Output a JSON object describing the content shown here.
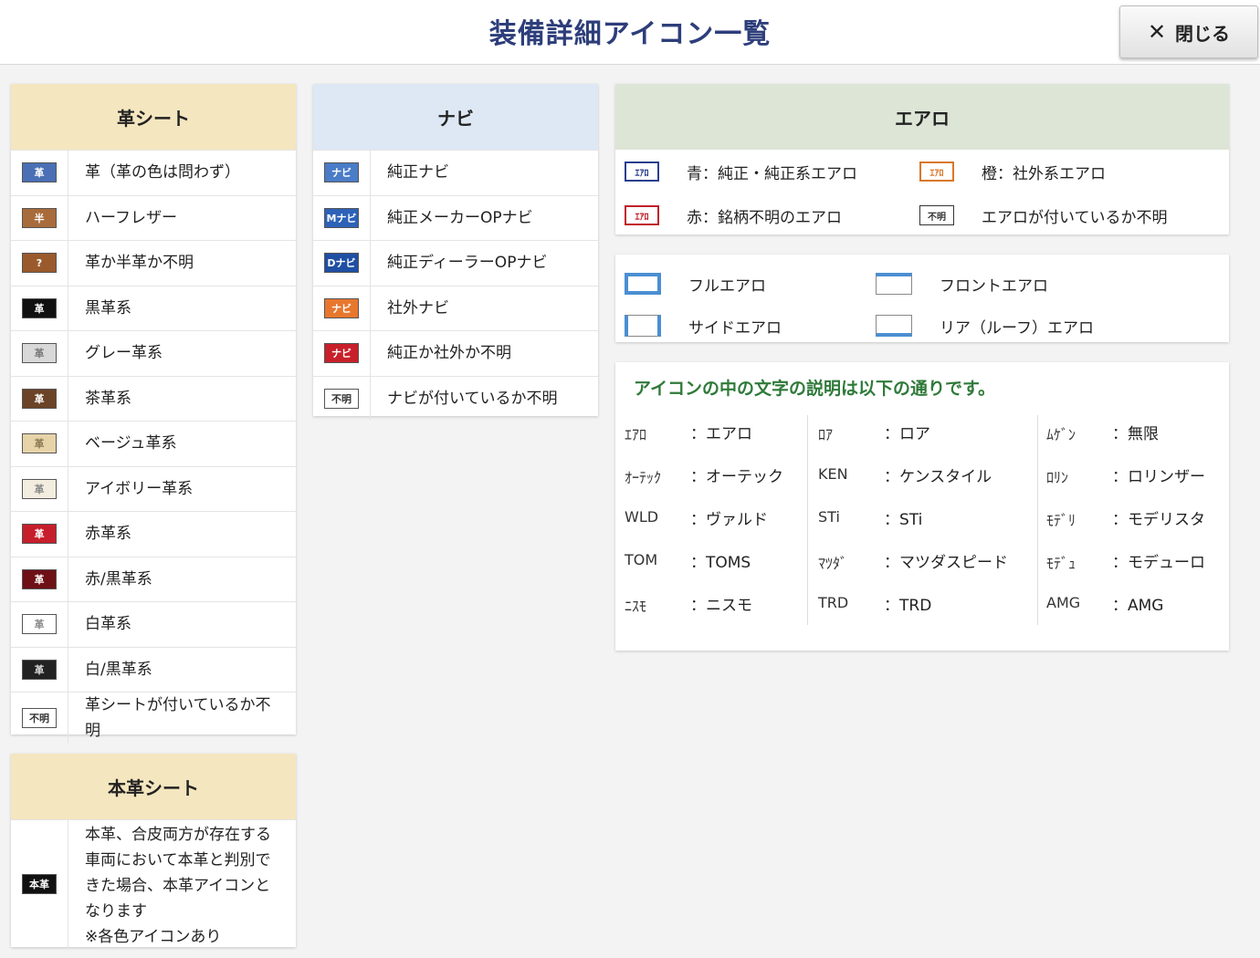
{
  "header": {
    "title": "装備詳細アイコン一覧",
    "close_label": "閉じる"
  },
  "leather": {
    "title": "革シート",
    "items": [
      {
        "icon": "革",
        "bg": "#4a6fb5",
        "fg": "#ffffff",
        "label": "革（革の色は問わず）"
      },
      {
        "icon": "半",
        "bg": "#a86b3b",
        "fg": "#ffffff",
        "label": "ハーフレザー"
      },
      {
        "icon": "?",
        "bg": "#9a5a2c",
        "fg": "#ffffff",
        "label": "革か半革か不明"
      },
      {
        "icon": "革",
        "bg": "#111111",
        "fg": "#ffffff",
        "label": "黒革系"
      },
      {
        "icon": "革",
        "bg": "#d8d8d8",
        "fg": "#777777",
        "label": "グレー革系"
      },
      {
        "icon": "革",
        "bg": "#6b4326",
        "fg": "#ffffff",
        "label": "茶革系"
      },
      {
        "icon": "革",
        "bg": "#e6d3a8",
        "fg": "#8a7650",
        "label": "ベージュ革系"
      },
      {
        "icon": "革",
        "bg": "#f3ede0",
        "fg": "#888888",
        "label": "アイボリー革系"
      },
      {
        "icon": "革",
        "bg": "#c71e2b",
        "fg": "#ffffff",
        "label": "赤革系"
      },
      {
        "icon": "革",
        "bg": "#6e1016",
        "fg": "#ffffff",
        "label": "赤/黒革系"
      },
      {
        "icon": "革",
        "bg": "#ffffff",
        "fg": "#888888",
        "label": "白革系"
      },
      {
        "icon": "革",
        "bg": "#222222",
        "fg": "#dddddd",
        "label": "白/黒革系"
      },
      {
        "icon": "不明",
        "bg": "#ffffff",
        "fg": "#333333",
        "label": "革シートが付いているか不明"
      }
    ]
  },
  "genuine": {
    "title": "本革シート",
    "icon": "本革",
    "text_lines": [
      "本革、合皮両方が存在する",
      "車両において本革と判別で",
      "きた場合、本革アイコンと",
      "なります",
      "※各色アイコンあり"
    ]
  },
  "navi": {
    "title": "ナビ",
    "items": [
      {
        "icon": "ナビ",
        "bg": "#4a7cc7",
        "fg": "#ffffff",
        "label": "純正ナビ"
      },
      {
        "icon": "Mナビ",
        "bg": "#2d62b8",
        "fg": "#ffffff",
        "label": "純正メーカーOPナビ"
      },
      {
        "icon": "Dナビ",
        "bg": "#1f4fa3",
        "fg": "#ffffff",
        "label": "純正ディーラーOPナビ"
      },
      {
        "icon": "ナビ",
        "bg": "#e8772e",
        "fg": "#ffffff",
        "label": "社外ナビ"
      },
      {
        "icon": "ナビ",
        "bg": "#c8202a",
        "fg": "#ffffff",
        "label": "純正か社外か不明"
      },
      {
        "icon": "不明",
        "bg": "#ffffff",
        "fg": "#333333",
        "label": "ナビが付いているか不明"
      }
    ]
  },
  "aero": {
    "title": "エアロ",
    "icon_text": "ｴｱﾛ",
    "unknown_icon": "不明",
    "rows": [
      {
        "a_color": "#2a3e8f",
        "a_label": "青：純正・純正系エアロ",
        "b_color": "#d9782a",
        "b_label": "橙：社外系エアロ"
      },
      {
        "a_color": "#c0202a",
        "a_label": "赤：銘柄不明のエアロ",
        "b_color": "#333333",
        "b_label": "エアロが付いているか不明"
      }
    ],
    "shapes": [
      {
        "label": "フルエアロ"
      },
      {
        "label": "フロントエアロ"
      },
      {
        "label": "サイドエアロ"
      },
      {
        "label": "リア（ルーフ）エアロ"
      }
    ]
  },
  "legend": {
    "heading": "アイコンの中の文字の説明は以下の通りです。",
    "columns": [
      [
        {
          "code": "ｴｱﾛ",
          "value": "：エアロ"
        },
        {
          "code": "ｵｰﾃｯｸ",
          "value": "：オーテック"
        },
        {
          "code": "WLD",
          "value": "：ヴァルド"
        },
        {
          "code": "TOM",
          "value": "：TOMS"
        },
        {
          "code": "ﾆｽﾓ",
          "value": "：ニスモ"
        }
      ],
      [
        {
          "code": "ﾛｱ",
          "value": "：ロア"
        },
        {
          "code": "KEN",
          "value": "：ケンスタイル"
        },
        {
          "code": "STi",
          "value": "：STi"
        },
        {
          "code": "ﾏﾂﾀﾞ",
          "value": "：マツダスピード"
        },
        {
          "code": "TRD",
          "value": "：TRD"
        }
      ],
      [
        {
          "code": "ﾑｹﾞﾝ",
          "value": "：無限"
        },
        {
          "code": "ﾛﾘﾝ",
          "value": "：ロリンザー"
        },
        {
          "code": "ﾓﾃﾞﾘ",
          "value": "：モデリスタ"
        },
        {
          "code": "ﾓﾃﾞｭ",
          "value": "：モデューロ"
        },
        {
          "code": "AMG",
          "value": "：AMG"
        }
      ]
    ]
  },
  "colors": {
    "leather_head": "#f4e6bf",
    "navi_head": "#dde8f4",
    "aero_head": "#dde5d6",
    "legend_heading": "#2f7a3a"
  }
}
